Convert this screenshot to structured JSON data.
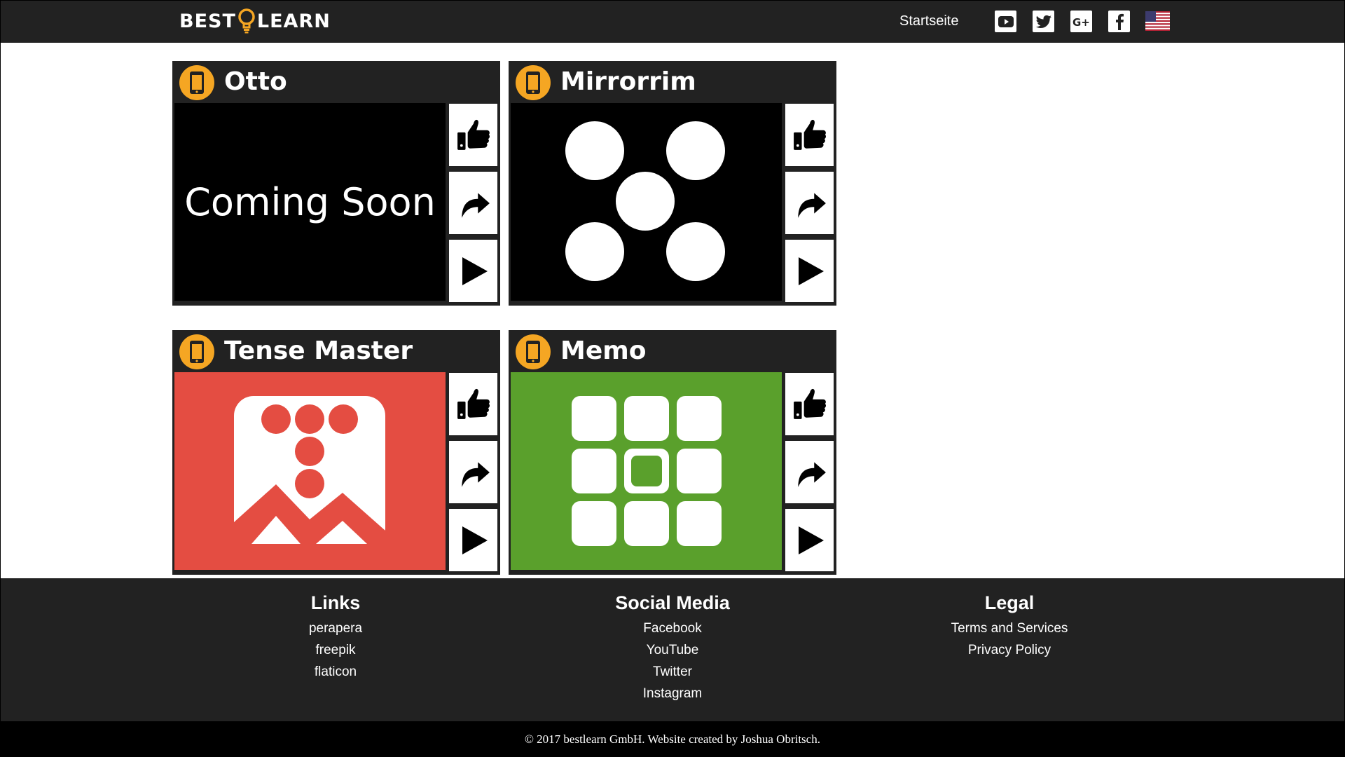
{
  "header": {
    "logo_left": "BEST",
    "logo_right": "LEARN",
    "nav_home": "Startseite",
    "social": [
      "youtube-icon",
      "twitter-icon",
      "google-plus-icon",
      "facebook-icon"
    ],
    "language": "us-flag-icon"
  },
  "cards": [
    {
      "title": "Otto",
      "image": "coming-soon",
      "image_text": "Coming Soon"
    },
    {
      "title": "Mirrorrim",
      "image": "five-dots-pattern"
    },
    {
      "title": "Tense Master",
      "image": "tense-master-logo"
    },
    {
      "title": "Memo",
      "image": "memo-grid"
    }
  ],
  "card_actions": [
    "thumbs-up-icon",
    "share-arrow-icon",
    "play-icon"
  ],
  "footer": {
    "links": {
      "heading": "Links",
      "items": [
        "perapera",
        "freepik",
        "flaticon"
      ]
    },
    "social": {
      "heading": "Social Media",
      "items": [
        "Facebook",
        "YouTube",
        "Twitter",
        "Instagram"
      ]
    },
    "legal": {
      "heading": "Legal",
      "items": [
        "Terms and Services",
        "Privacy Policy"
      ]
    },
    "copyright": "© 2017 bestlearn GmbH. Website created by Joshua Obritsch."
  },
  "colors": {
    "header_bg": "#222222",
    "accent": "#f5a623",
    "tense_bg": "#e44d42",
    "memo_bg": "#5aa02c"
  }
}
